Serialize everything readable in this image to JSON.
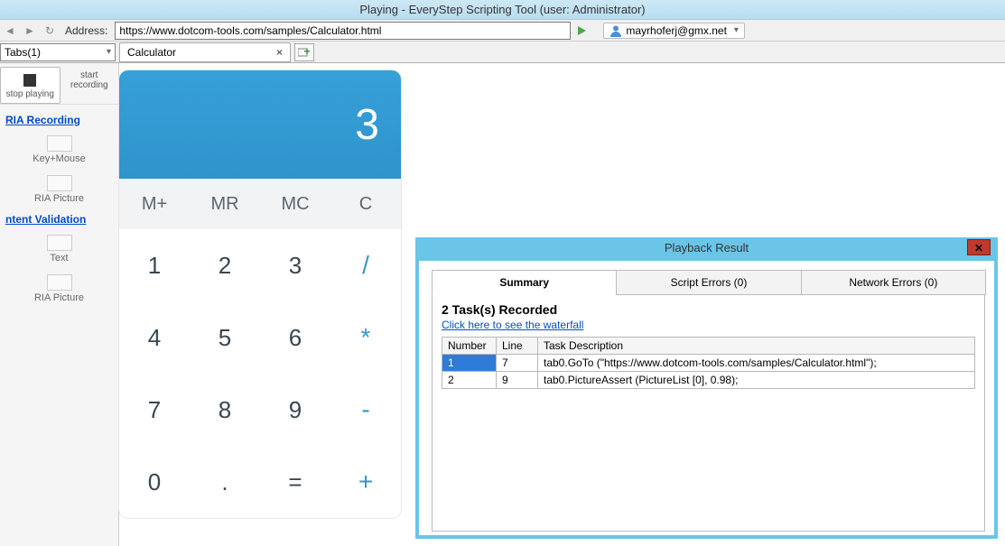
{
  "window": {
    "title": "Playing - EveryStep Scripting Tool (user: Administrator)"
  },
  "addressbar": {
    "label": "Address:",
    "url": "https://www.dotcom-tools.com/samples/Calculator.html",
    "user": "mayrhoferj@gmx.net"
  },
  "tabs": {
    "combo": "Tabs(1)",
    "active": "Calculator"
  },
  "toolbar": {
    "stop": "stop playing",
    "start": "start recording"
  },
  "sidebar": {
    "section1": "RIA Recording",
    "keymouse": "Key+Mouse",
    "riapic1": "RIA Picture",
    "section2": "ntent Validation",
    "text": "Text",
    "riapic2": "RIA Picture"
  },
  "calculator": {
    "display": "3",
    "mem": [
      "M+",
      "MR",
      "MC",
      "C"
    ],
    "keys": [
      [
        "1",
        "2",
        "3",
        "/"
      ],
      [
        "4",
        "5",
        "6",
        "*"
      ],
      [
        "7",
        "8",
        "9",
        "-"
      ],
      [
        "0",
        ".",
        "=",
        "+"
      ]
    ]
  },
  "playback": {
    "title": "Playback Result",
    "tabs": {
      "summary": "Summary",
      "scriptErrors": "Script Errors (0)",
      "networkErrors": "Network Errors (0)"
    },
    "heading": "2 Task(s) Recorded",
    "link": "Click here to see the waterfall",
    "columns": {
      "number": "Number",
      "line": "Line",
      "desc": "Task Description"
    },
    "rows": [
      {
        "num": "1",
        "line": "7",
        "desc": "tab0.GoTo (\"https://www.dotcom-tools.com/samples/Calculator.html\");",
        "selected": true
      },
      {
        "num": "2",
        "line": "9",
        "desc": "tab0.PictureAssert (PictureList [0], 0.98);",
        "selected": false
      }
    ]
  }
}
